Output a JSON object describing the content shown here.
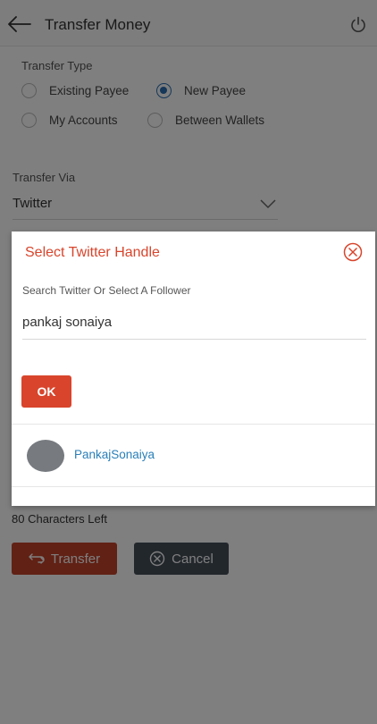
{
  "header": {
    "title": "Transfer Money"
  },
  "transfer_type": {
    "label": "Transfer Type",
    "options": [
      {
        "label": "Existing Payee",
        "selected": false
      },
      {
        "label": "New Payee",
        "selected": true
      },
      {
        "label": "My Accounts",
        "selected": false
      },
      {
        "label": "Between Wallets",
        "selected": false
      }
    ]
  },
  "transfer_via": {
    "label": "Transfer Via",
    "value": "Twitter"
  },
  "footer": {
    "chars_left": "80 Characters Left",
    "transfer_label": "Transfer",
    "cancel_label": "Cancel"
  },
  "dialog": {
    "title": "Select Twitter Handle",
    "field_label": "Search Twitter Or Select A Follower",
    "field_value": "pankaj sonaiya",
    "ok_label": "OK",
    "followers": [
      {
        "name": "PankajSonaiya"
      }
    ]
  },
  "colors": {
    "accent_red": "#d8452c",
    "link_blue": "#2a7fb8",
    "radio_blue": "#2a6fb2",
    "cancel_gray": "#454e59"
  }
}
